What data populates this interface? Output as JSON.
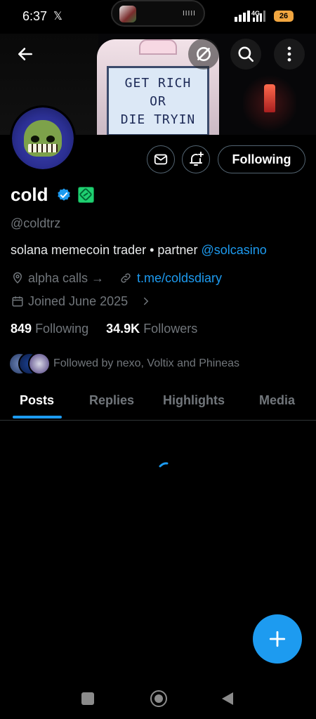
{
  "status_bar": {
    "time": "6:37",
    "x_notification": "𝕏",
    "pill_dots": "IIIII",
    "network": "4G",
    "battery": "26"
  },
  "banner": {
    "sign_lines": [
      "GET RICH",
      "OR",
      "DIE TRYIN"
    ]
  },
  "top_bar": {
    "back_icon": "arrow-left-icon",
    "grok_icon": "slash-circle-icon",
    "search_icon": "search-icon",
    "more_icon": "more-vertical-icon"
  },
  "profile": {
    "name": "cold",
    "handle": "@coldtrz",
    "bio_text": "solana memecoin trader • partner ",
    "bio_mention": "@solcasino",
    "location": "alpha calls →",
    "link": "t.me/coldsdiary",
    "joined": "Joined June 2025",
    "following_count": "849",
    "following_label": "Following",
    "followers_count": "34.9K",
    "followers_label": "Followers",
    "followed_by": "Followed by nexo, Voltix and Phineas"
  },
  "actions": {
    "message_icon": "mail-icon",
    "notify_icon": "bell-plus-icon",
    "following_button": "Following"
  },
  "tabs": [
    {
      "label": "Posts",
      "active": true
    },
    {
      "label": "Replies",
      "active": false
    },
    {
      "label": "Highlights",
      "active": false
    },
    {
      "label": "Media",
      "active": false
    }
  ],
  "fab": {
    "icon": "plus-icon"
  },
  "colors": {
    "accent": "#1d9bf0",
    "background": "#000000",
    "muted": "#71767b",
    "affiliate": "#1fd071"
  }
}
